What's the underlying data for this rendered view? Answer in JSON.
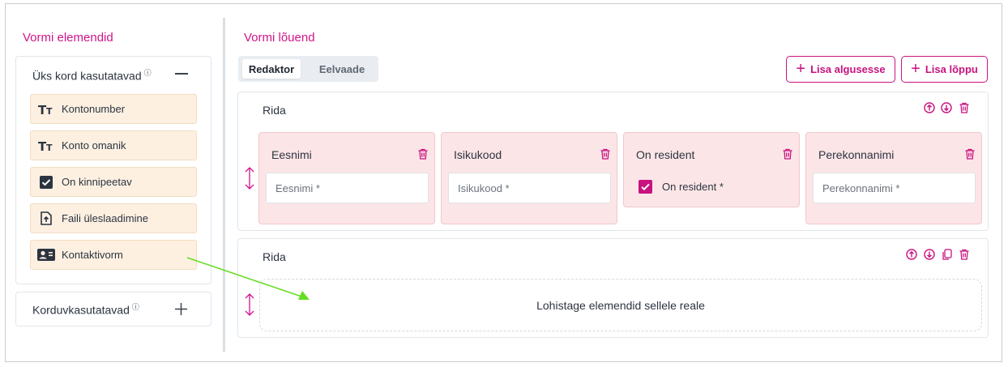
{
  "sidebar": {
    "heading": "Vormi elemendid",
    "single_use": {
      "title": "Üks kord kasutatavad",
      "info": "i",
      "items": [
        {
          "label": "Kontonumber",
          "icon": "text-type-icon"
        },
        {
          "label": "Konto omanik",
          "icon": "text-type-icon"
        },
        {
          "label": "On kinnipeetav",
          "icon": "checkbox-icon"
        },
        {
          "label": "Faili üleslaadimine",
          "icon": "file-upload-icon"
        },
        {
          "label": "Kontaktivorm",
          "icon": "contact-card-icon"
        }
      ]
    },
    "reusable": {
      "title": "Korduvkasutatavad",
      "info": "i"
    }
  },
  "canvas": {
    "heading": "Vormi lõuend",
    "tabs": [
      {
        "label": "Redaktor",
        "active": true
      },
      {
        "label": "Eelvaade",
        "active": false
      }
    ],
    "add_start_label": "Lisa algusesse",
    "add_end_label": "Lisa lõppu",
    "rows": [
      {
        "title": "Rida",
        "fields": [
          {
            "title": "Eesnimi",
            "type": "input",
            "placeholder": "Eesnimi *"
          },
          {
            "title": "Isikukood",
            "type": "input",
            "placeholder": "Isikukood *"
          },
          {
            "title": "On resident",
            "type": "checkbox",
            "checkbox_label": "On resident *",
            "checked": true
          },
          {
            "title": "Perekonnanimi",
            "type": "input",
            "placeholder": "Perekonnanimi *"
          }
        ]
      },
      {
        "title": "Rida",
        "dropzone_text": "Lohistage elemendid sellele reale"
      }
    ]
  },
  "colors": {
    "accent": "#d0148a",
    "element_bg": "#fdf0e1",
    "field_bg": "#fce5e7",
    "drag_arrow": "#66dd22"
  }
}
